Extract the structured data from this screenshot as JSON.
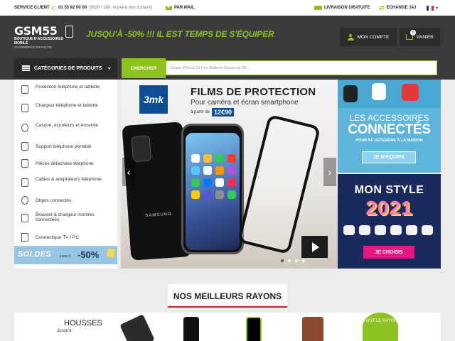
{
  "topbar": {
    "service_client": "SERVICE CLIENT",
    "phone": "01 55 82 00 00",
    "hours": "(9h30 / 18h, numéro non surtaxé)",
    "mail": "PAR MAIL",
    "livraison": "LIVRAISON GRATUITE",
    "echange": "ECHANGE 14J"
  },
  "header": {
    "logo_main": "GSM55",
    "logo_sub": "BOUTIQUE D'ACCESSOIRES MOBILE",
    "logo_sub2": "#COMMERCE FRANÇAIS",
    "promo": "JUSQU'À -50% !!! IL EST TEMPS DE S'ÉQUIPER",
    "account": "MON COMPTE",
    "cart": "PANIER",
    "cart_count": "0"
  },
  "nav": {
    "categories": "CATÉGORIES DE PRODUITS",
    "search_label": "CHERCHER",
    "search_placeholder": "Coque iPhone 12 Pro, Batterie Samsung S9 ..."
  },
  "sidebar": {
    "items": [
      {
        "label": "Protection téléphone et tablette",
        "icon": "phone-icon"
      },
      {
        "label": "Chargeur téléphone et tablette",
        "icon": "charger-icon"
      },
      {
        "label": "Casque, écouteurs et enceinte",
        "icon": "headphones-icon"
      },
      {
        "label": "Support téléphone portable",
        "icon": "phone-holder-icon"
      },
      {
        "label": "Pièces détachées téléphone",
        "icon": "spare-parts-icon"
      },
      {
        "label": "Cables & adaptateurs téléphone",
        "icon": "cable-icon"
      },
      {
        "label": "Objets connectés",
        "icon": "smartwatch-icon"
      },
      {
        "label": "Bracelet & chargeur montres connectées",
        "icon": "watch-band-icon"
      },
      {
        "label": "Connectique TV / PC",
        "icon": "tv-icon"
      }
    ],
    "soldes": {
      "title": "SOLDES",
      "small": "jusqu'à",
      "pct": "-50%"
    }
  },
  "hero": {
    "brand": "3mk",
    "title": "FILMS DE PROTECTION",
    "subtitle": "Pour caméra et écran smartphone",
    "price_prefix": "à partir de",
    "price": "12€90",
    "phone_brand": "SAMSUNG"
  },
  "banner1": {
    "line1": "LES ACCESSOIRES",
    "line2": "CONNECTÉS",
    "line3": "POUR SE DÉTENDRE À LA MAISON",
    "cta": "JE M'ÉQUIPE"
  },
  "banner2": {
    "line1": "MON STYLE",
    "line2": "2021",
    "cta": "JE CHOISIS"
  },
  "rayons": {
    "title": "NOS MEILLEURS RAYONS",
    "housses": "HOUSSES",
    "jusqua": "Jusqu'à",
    "tout": "TOUT LE RAYON"
  },
  "colors": {
    "accent": "#8dc21f",
    "dark": "#3a3a3a",
    "title_underline": "#c62828"
  }
}
